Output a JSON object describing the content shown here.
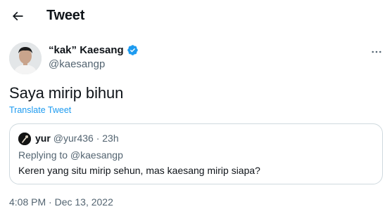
{
  "header": {
    "title": "Tweet",
    "back_icon": "arrow-left-icon"
  },
  "author": {
    "display_name": "“kak” Kaesang",
    "handle": "@kaesangp",
    "verified_icon": "verified-badge-icon",
    "verified_color": "#1d9bf0"
  },
  "tweet": {
    "text": "Saya mirip bihun",
    "translate_label": "Translate Tweet",
    "timestamp": "4:08 PM · Dec 13, 2022"
  },
  "quoted": {
    "name": "yur",
    "meta": "@yur436 · 23h",
    "replying_to": "Replying to @kaesangp",
    "text": "Keren yang situ mirip sehun, mas kaesang mirip siapa?"
  },
  "colors": {
    "accent": "#1d9bf0",
    "secondary_text": "#536471",
    "border": "#cfd9de"
  }
}
